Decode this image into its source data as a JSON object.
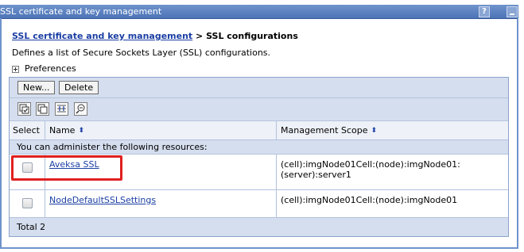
{
  "window": {
    "title": "SSL certificate and key management",
    "help_label": "?"
  },
  "breadcrumb": {
    "link": "SSL certificate and key management",
    "separator": " > ",
    "current": "SSL configurations"
  },
  "description": "Defines a list of Secure Sockets Layer (SSL) configurations.",
  "preferences_label": "Preferences",
  "buttons": {
    "new_label": "New...",
    "delete_label": "Delete"
  },
  "toolbar_icons": [
    "select-all-icon",
    "deselect-all-icon",
    "expand-filter-icon",
    "clear-filter-icon"
  ],
  "table": {
    "headers": {
      "select": "Select",
      "name": "Name",
      "scope": "Management Scope"
    },
    "info_text": "You can administer the following resources:",
    "rows": [
      {
        "name": "Aveksa SSL",
        "scope_line1": "(cell):imgNode01Cell:(node):imgNode01:",
        "scope_line2": "(server):server1"
      },
      {
        "name": "NodeDefaultSSLSettings",
        "scope_line1": "(cell):imgNode01Cell:(node):imgNode01",
        "scope_line2": ""
      }
    ],
    "total": "Total 2"
  },
  "colors": {
    "titlebar": "#4c74b7",
    "link": "#1a3ea3",
    "table_band": "#d5deee",
    "highlight": "#e02020"
  }
}
